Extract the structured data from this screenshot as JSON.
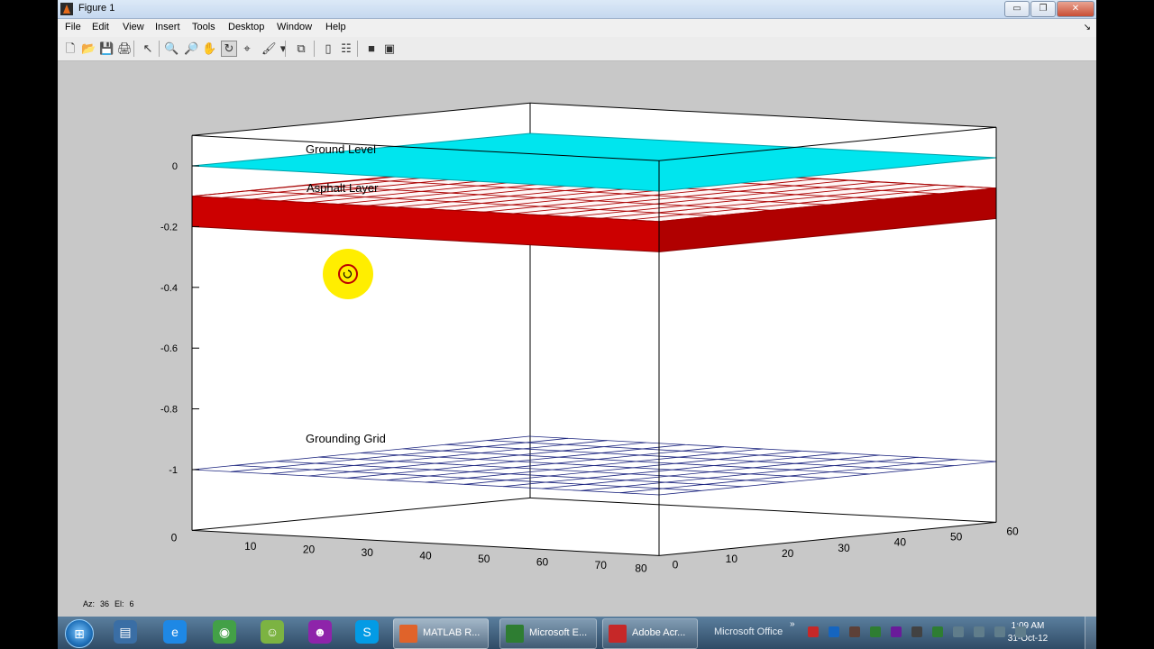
{
  "window": {
    "title": "Figure 1",
    "buttons": {
      "minimize": "▭",
      "restore": "❐",
      "close": "✕"
    }
  },
  "menu": {
    "items": [
      "File",
      "Edit",
      "View",
      "Insert",
      "Tools",
      "Desktop",
      "Window",
      "Help"
    ],
    "overflow_arrow": "↘"
  },
  "toolbar": {
    "buttons": [
      {
        "name": "new-figure-icon",
        "glyph": "🗋"
      },
      {
        "name": "open-file-icon",
        "glyph": "📂"
      },
      {
        "name": "save-icon",
        "glyph": "💾"
      },
      {
        "name": "print-icon",
        "glyph": "🖨"
      },
      {
        "name": "edit-plot-arrow-icon",
        "glyph": "↖"
      },
      {
        "name": "zoom-in-icon",
        "glyph": "🔍"
      },
      {
        "name": "zoom-out-icon",
        "glyph": "🔎"
      },
      {
        "name": "pan-hand-icon",
        "glyph": "✋"
      },
      {
        "name": "rotate-3d-icon",
        "glyph": "↻",
        "pressed": true
      },
      {
        "name": "data-cursor-icon",
        "glyph": "⌖"
      },
      {
        "name": "brush-icon",
        "glyph": "🖌"
      },
      {
        "name": "brush-dropdown-icon",
        "glyph": "▾"
      },
      {
        "name": "link-plot-icon",
        "glyph": "⧉"
      },
      {
        "name": "colorbar-icon",
        "glyph": "▯"
      },
      {
        "name": "legend-icon",
        "glyph": "☷"
      },
      {
        "name": "hide-plot-tools-icon",
        "glyph": "■"
      },
      {
        "name": "show-plot-tools-icon",
        "glyph": "▣"
      }
    ]
  },
  "chart_data": {
    "type": "surface3d",
    "view": {
      "azimuth": 36,
      "elevation": 6
    },
    "xlim": [
      0,
      80
    ],
    "ylim": [
      0,
      60
    ],
    "zlim": [
      -1.2,
      0.1
    ],
    "x_ticks": [
      "10",
      "20",
      "30",
      "40",
      "50",
      "60",
      "70",
      "80"
    ],
    "y_ticks": [
      "0",
      "10",
      "20",
      "30",
      "40",
      "50",
      "60"
    ],
    "z_ticks": [
      "0",
      "-0.2",
      "-0.4",
      "-0.6",
      "-0.8",
      "-1"
    ],
    "corner_zero_label": "0",
    "layers": [
      {
        "label": "Ground Level",
        "z": 0,
        "style": "filled plane",
        "color": "#00e5ee"
      },
      {
        "label": "Asphalt Layer",
        "z_top": -0.1,
        "z_bottom": -0.2,
        "style": "solid slab with mesh",
        "color": "#cc0000"
      },
      {
        "label": "Grounding Grid",
        "z": -1,
        "style": "wire mesh",
        "color": "#1a237e"
      }
    ],
    "cursor_highlight_color": "#ffee00"
  },
  "status": {
    "az_label": "Az:",
    "az_value": "36",
    "el_label": "El:",
    "el_value": "6"
  },
  "taskbar": {
    "pinned": [
      {
        "name": "windows-explorer-icon",
        "glyph": "▤",
        "color": "#3a6ea5"
      },
      {
        "name": "internet-explorer-icon",
        "glyph": "e",
        "color": "#1e88e5"
      },
      {
        "name": "chrome-icon",
        "glyph": "◉",
        "color": "#43a047"
      },
      {
        "name": "messenger-icon",
        "glyph": "☺",
        "color": "#7cb342"
      },
      {
        "name": "media-app-icon",
        "glyph": "☻",
        "color": "#8e24aa"
      },
      {
        "name": "skype-icon",
        "glyph": "S",
        "color": "#039be5"
      }
    ],
    "tasks": [
      {
        "name": "task-matlab",
        "label": "MATLAB R...",
        "color": "#e0632a",
        "active": true
      },
      {
        "name": "task-excel",
        "label": "Microsoft E...",
        "color": "#2e7d32",
        "active": false
      },
      {
        "name": "task-acrobat",
        "label": "Adobe Acr...",
        "color": "#c62828",
        "active": false
      }
    ],
    "toolbar_name": "Microsoft Office",
    "chevron": "»",
    "tray": [
      {
        "name": "tray-acrobat-icon",
        "color": "#c62828"
      },
      {
        "name": "tray-outlook-icon",
        "color": "#1565c0"
      },
      {
        "name": "tray-calendar-icon",
        "color": "#5d4037"
      },
      {
        "name": "tray-excel-icon",
        "color": "#2e7d32"
      },
      {
        "name": "tray-access-icon",
        "color": "#6a1b9a"
      },
      {
        "name": "tray-card-icon",
        "color": "#424242"
      },
      {
        "name": "tray-check-icon",
        "color": "#2e7d32"
      },
      {
        "name": "tray-flag-icon",
        "color": "#607d8b"
      },
      {
        "name": "tray-device-icon",
        "color": "#607d8b"
      },
      {
        "name": "tray-network-icon",
        "color": "#607d8b"
      },
      {
        "name": "tray-volume-icon",
        "color": "#607d8b"
      }
    ],
    "clock": {
      "time": "1:09 AM",
      "date": "31-Oct-12"
    }
  }
}
